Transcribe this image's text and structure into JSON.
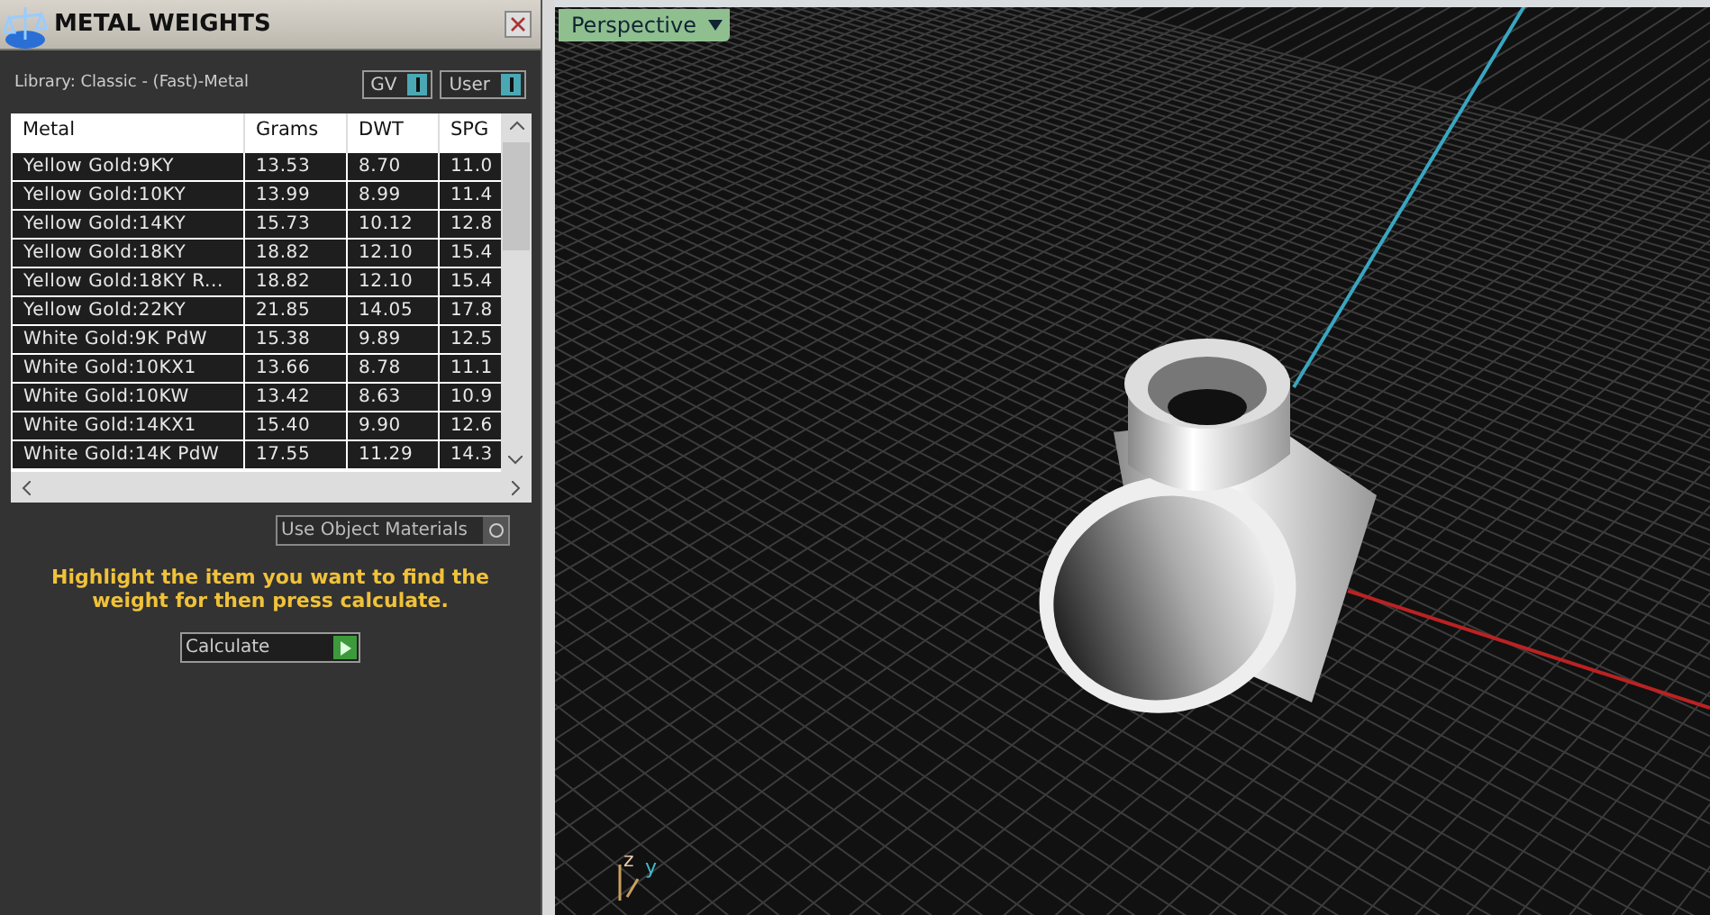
{
  "panel": {
    "title": "METAL WEIGHTS",
    "library": "Library: Classic - (Fast)-Metal",
    "toggles": [
      {
        "label": "GV",
        "on": true
      },
      {
        "label": "User",
        "on": true
      }
    ],
    "table": {
      "columns": [
        "Metal",
        "Grams",
        "DWT",
        "SPG"
      ],
      "rows": [
        [
          "Yellow Gold:9KY",
          "13.53",
          "8.70",
          "11.0"
        ],
        [
          "Yellow Gold:10KY",
          "13.99",
          "8.99",
          "11.4"
        ],
        [
          "Yellow Gold:14KY",
          "15.73",
          "10.12",
          "12.8"
        ],
        [
          "Yellow Gold:18KY",
          "18.82",
          "12.10",
          "15.4"
        ],
        [
          "Yellow Gold:18KY R...",
          "18.82",
          "12.10",
          "15.4"
        ],
        [
          "Yellow Gold:22KY",
          "21.85",
          "14.05",
          "17.8"
        ],
        [
          "White Gold:9K PdW",
          "15.38",
          "9.89",
          "12.5"
        ],
        [
          "White Gold:10KX1",
          "13.66",
          "8.78",
          "11.1"
        ],
        [
          "White Gold:10KW",
          "13.42",
          "8.63",
          "10.9"
        ],
        [
          "White Gold:14KX1",
          "15.40",
          "9.90",
          "12.6"
        ],
        [
          "White Gold:14K PdW",
          "17.55",
          "11.29",
          "14.3"
        ]
      ]
    },
    "use_object_materials": {
      "label": "Use Object Materials",
      "checked": false
    },
    "hint": "Highlight the item you want to find the weight for then press calculate.",
    "button": "Calculate"
  },
  "viewport": {
    "label": "Perspective",
    "axes": [
      "z",
      "y"
    ]
  }
}
